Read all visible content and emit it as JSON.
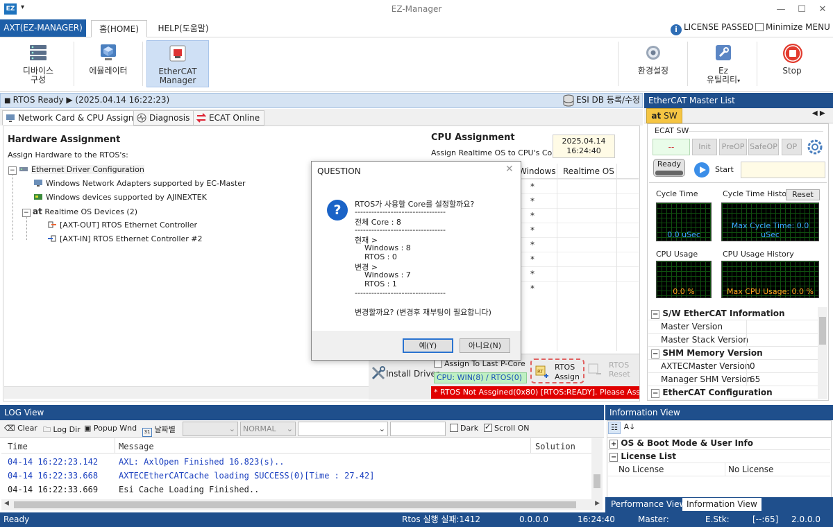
{
  "window": {
    "title": "EZ-Manager",
    "app_icon": "EZ",
    "menu_glyph": "▾"
  },
  "ribbon_tabs": {
    "app": "AXT(EZ-MANAGER)",
    "home": "홈(HOME)",
    "help": "HELP(도움말)"
  },
  "top_right": {
    "license": "LICENSE PASSED",
    "minimize_menu": "Minimize MENU"
  },
  "ribbon": {
    "device": [
      "디바이스",
      "구성"
    ],
    "emulator": "에뮬레이터",
    "ethercat_manager": [
      "EtherCAT",
      "Manager"
    ],
    "env": "환경설정",
    "ez_util": [
      "Ez",
      "유틸리티"
    ],
    "stop": "Stop"
  },
  "status_top": {
    "text": "RTOS Ready ▶ (2025.04.14 16:22:23)",
    "esi": "ESI DB 등록/수정"
  },
  "subtabs": [
    "Network Card & CPU Assign",
    "Diagnosis",
    "ECAT Online"
  ],
  "hardware": {
    "title": "Hardware Assignment",
    "subtitle": "Assign Hardware to the RTOS's:",
    "tree": [
      "Ethernet Driver Configuration",
      "Windows Network Adapters supported by EC-Master",
      "Windows devices supported by AJINEXTEK",
      "Realtime OS Devices (2)",
      "[AXT-OUT] RTOS Ethernet Controller",
      "[AXT-IN] RTOS Ethernet Controller #2"
    ]
  },
  "cpu": {
    "title": "CPU Assignment",
    "subtitle": "Assign Realtime OS to CPU's Core:",
    "date": "2025.04.14",
    "time": "16:24:40",
    "col_windows": "Windows",
    "col_rtos": "Realtime OS",
    "rows": [
      "*",
      "*",
      "*",
      "*",
      "*",
      "*",
      "*",
      "*"
    ]
  },
  "strip": {
    "install": "Install Driver",
    "assign_last": "Assign To Last P-Core",
    "cpu_status": "CPU: WIN(8) / RTOS(0)",
    "rtos_assign": [
      "RTOS",
      "Assign"
    ],
    "rtos_reset": [
      "RTOS",
      "Reset"
    ],
    "error": "* RTOS Not Assgined(0x80) [RTOS:READY]. Please Assign CPU"
  },
  "master_list": {
    "title": "EtherCAT Master List",
    "tab_prefix": "at",
    "tab": "SW",
    "ecat_sw": "ECAT SW",
    "state": "--",
    "buttons": [
      "Init",
      "PreOP",
      "SafeOP",
      "OP"
    ],
    "ready": "Ready",
    "start": "Start",
    "cycle_time": "Cycle Time",
    "cycle_value": "0.0 uSec",
    "cycle_history": "Cycle Time History",
    "reset": "Reset",
    "max_cycle": "Max Cycle Time: 0.0 uSec",
    "cpu_usage": "CPU Usage",
    "cpu_value": "0.0 %",
    "cpu_history": "CPU Usage History",
    "max_cpu": "Max CPU Usage: 0.0 %",
    "grid": [
      {
        "cat": "S/W EtherCAT Information"
      },
      {
        "name": "Master Version",
        "value": ""
      },
      {
        "name": "Master Stack Version",
        "value": ""
      },
      {
        "cat": "SHM Memory Version"
      },
      {
        "name": "AXTECMaster Version",
        "value": "0"
      },
      {
        "name": "Manager SHM Version",
        "value": "65"
      },
      {
        "cat": "EtherCAT Configuration"
      }
    ]
  },
  "log": {
    "title": "LOG View",
    "clear": "Clear",
    "log_dir": "Log Dir",
    "popup": "Popup Wnd",
    "by_date": "날짜별",
    "level": "NORMAL",
    "dark": "Dark",
    "scroll_on": "Scroll ON",
    "col_time": "Time",
    "col_message": "Message",
    "col_solution": "Solution",
    "rows": [
      {
        "time": "04-14 16:22:23.142",
        "msg": "AXL: AxlOpen Finished 16.823(s)..",
        "color": "#1a3fbf"
      },
      {
        "time": "04-14 16:22:33.668",
        "msg": "AXTECEtherCATCache loading SUCCESS(0)[Time : 27.42]",
        "color": "#1a3fbf"
      },
      {
        "time": "04-14 16:22:33.669",
        "msg": "Esi Cache Loading Finished..",
        "color": "#222222"
      }
    ]
  },
  "info": {
    "title": "Information View",
    "os_boot": "OS & Boot Mode & User Info",
    "license_list": "License List",
    "no_license_1": "No License",
    "no_license_2": "No License",
    "tab_perf": "Performance View",
    "tab_info": "Information View"
  },
  "statusbar": {
    "ready": "Ready",
    "rtos_fail": "Rtos 실행 실패:1412",
    "ver": "0.0.0.0",
    "time": "16:24:40",
    "master": "Master:",
    "estk": "E.Stk:",
    "code": "[--:65]",
    "app_ver": "2.0.0.0"
  },
  "dialog": {
    "title": "QUESTION",
    "lines": [
      "RTOS가 사용할 Core를 설정할까요?",
      "---------------------------------",
      "전체 Core : 8",
      "---------------------------------",
      "현재 >",
      "    Windows : 8",
      "    RTOS : 0",
      "변경 >",
      "    Windows : 7",
      "    RTOS : 1",
      "---------------------------------",
      "변경할까요? (변경후 재부팅이 필요합니다)"
    ],
    "yes": "예(Y)",
    "no": "아니요(N)"
  },
  "colors": {
    "accent": "#1f4f8c",
    "error": "#e00000",
    "ok_green": "#bff0c2"
  }
}
